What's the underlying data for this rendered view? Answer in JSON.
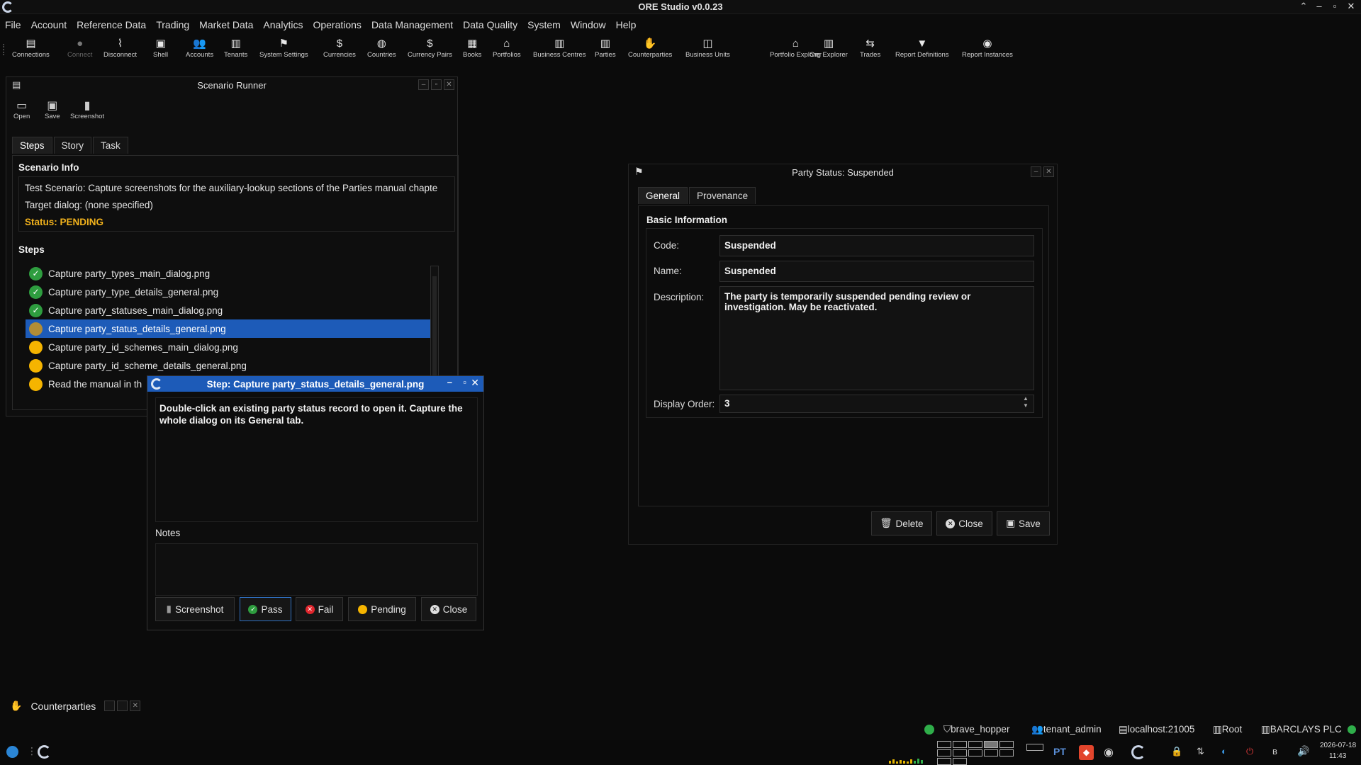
{
  "app": {
    "title": "ORE Studio v0.0.23"
  },
  "menu": [
    "File",
    "Account",
    "Reference Data",
    "Trading",
    "Market Data",
    "Analytics",
    "Operations",
    "Data Management",
    "Data Quality",
    "System",
    "Window",
    "Help"
  ],
  "toolbar": [
    {
      "label": "Connections",
      "icon": "connections-icon"
    },
    {
      "label": "Connect",
      "icon": "connect-icon"
    },
    {
      "label": "Disconnect",
      "icon": "disconnect-icon"
    },
    {
      "label": "Shell",
      "icon": "shell-icon"
    },
    {
      "label": "Accounts",
      "icon": "accounts-icon"
    },
    {
      "label": "Tenants",
      "icon": "tenants-icon"
    },
    {
      "label": "System Settings",
      "icon": "flag-icon"
    },
    {
      "label": "Currencies",
      "icon": "currency-icon"
    },
    {
      "label": "Countries",
      "icon": "globe-icon"
    },
    {
      "label": "Currency Pairs",
      "icon": "currency-pair-icon"
    },
    {
      "label": "Books",
      "icon": "book-icon"
    },
    {
      "label": "Portfolios",
      "icon": "portfolio-icon"
    },
    {
      "label": "Business Centres",
      "icon": "building-icon"
    },
    {
      "label": "Parties",
      "icon": "parties-icon"
    },
    {
      "label": "Counterparties",
      "icon": "handshake-icon"
    },
    {
      "label": "Business Units",
      "icon": "units-icon"
    },
    {
      "label": "Portfolio Explorer",
      "icon": "portfolio-explorer-icon"
    },
    {
      "label": "Org Explorer",
      "icon": "org-explorer-icon"
    },
    {
      "label": "Trades",
      "icon": "trades-icon"
    },
    {
      "label": "Report Definitions",
      "icon": "report-definitions-icon"
    },
    {
      "label": "Report Instances",
      "icon": "report-instances-icon"
    }
  ],
  "scenario": {
    "title": "Scenario Runner",
    "tools": {
      "open": "Open",
      "save": "Save",
      "screenshot": "Screenshot"
    },
    "tabs": [
      "Steps",
      "Story",
      "Task"
    ],
    "info_title": "Scenario Info",
    "info_line1": "Test Scenario: Capture screenshots for the auxiliary-lookup sections of the Parties manual chapte",
    "info_line2": "Target dialog: (none specified)",
    "status": "Status: PENDING",
    "steps_title": "Steps",
    "steps": [
      {
        "label": "Capture party_types_main_dialog.png",
        "state": "done"
      },
      {
        "label": "Capture party_type_details_general.png",
        "state": "done"
      },
      {
        "label": "Capture party_statuses_main_dialog.png",
        "state": "done"
      },
      {
        "label": "Capture party_status_details_general.png",
        "state": "current"
      },
      {
        "label": "Capture party_id_schemes_main_dialog.png",
        "state": "pending"
      },
      {
        "label": "Capture party_id_scheme_details_general.png",
        "state": "pending"
      },
      {
        "label": "Read the manual in th",
        "state": "pending"
      }
    ]
  },
  "step_dialog": {
    "title": "Step: Capture party_status_details_general.png",
    "instructions": "Double-click an existing party status record to open it. Capture the whole dialog on its General tab.",
    "notes_label": "Notes",
    "buttons": {
      "screenshot": "Screenshot",
      "pass": "Pass",
      "fail": "Fail",
      "pending": "Pending",
      "close": "Close"
    }
  },
  "party_status": {
    "title": "Party Status: Suspended",
    "tabs": [
      "General",
      "Provenance"
    ],
    "group": "Basic Information",
    "code_label": "Code:",
    "code": "Suspended",
    "name_label": "Name:",
    "name": "Suspended",
    "description_label": "Description:",
    "description": "The party is temporarily suspended pending review or investigation. May be reactivated.",
    "order_label": "Display Order:",
    "order": "3",
    "buttons": {
      "delete": "Delete",
      "close": "Close",
      "save": "Save"
    }
  },
  "counterparties_dock": {
    "title": "Counterparties"
  },
  "statusbar": {
    "user": "brave_hopper",
    "tenant": "tenant_admin",
    "server": "localhost:21005",
    "root": "Root",
    "party": "BARCLAYS PLC",
    "connection_color": "#2fae4a"
  },
  "taskbar": {
    "lang": "PT",
    "date": "2026-07-18",
    "time": "11:43"
  }
}
